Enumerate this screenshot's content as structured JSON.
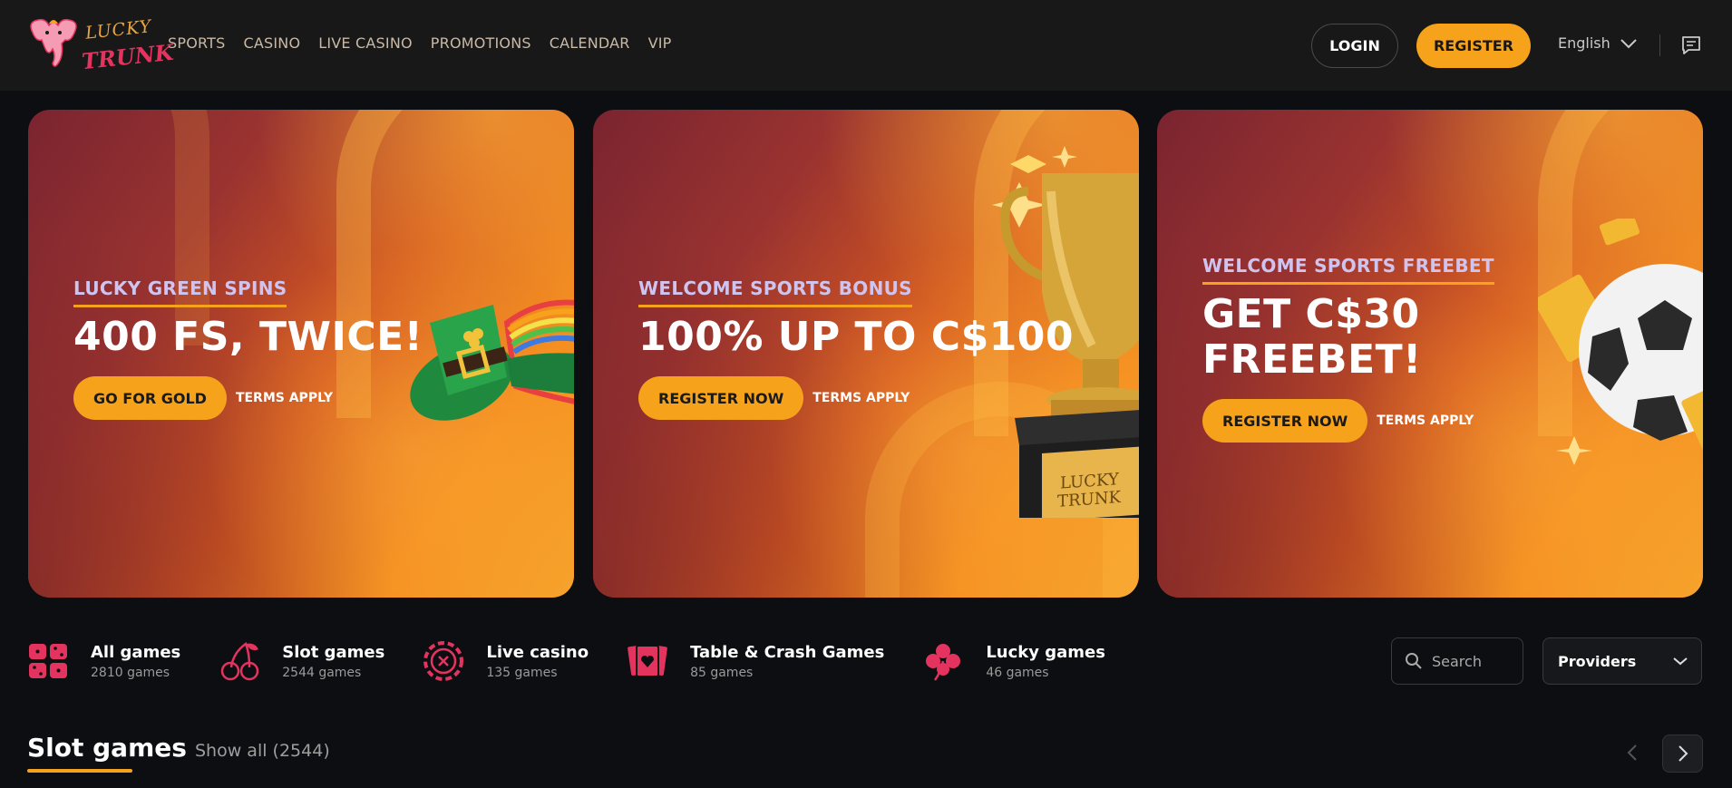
{
  "header": {
    "logo_line1": "LUCKY",
    "logo_line2": "TRUNK",
    "nav": [
      "SPORTS",
      "CASINO",
      "LIVE CASINO",
      "PROMOTIONS",
      "CALENDAR",
      "VIP"
    ],
    "login_label": "LOGIN",
    "register_label": "REGISTER",
    "language": "English"
  },
  "banners": [
    {
      "subtitle": "LUCKY GREEN SPINS",
      "title_lines": [
        "400 FS, TWICE!"
      ],
      "button": "GO FOR GOLD",
      "terms": "TERMS APPLY"
    },
    {
      "subtitle": "WELCOME SPORTS BONUS",
      "title_lines": [
        "100% UP TO C$100"
      ],
      "button": "REGISTER NOW",
      "terms": "TERMS APPLY"
    },
    {
      "subtitle": "WELCOME SPORTS FREEBET",
      "title_lines": [
        "GET C$30",
        "FREEBET!"
      ],
      "button": "REGISTER NOW",
      "terms": "TERMS APPLY"
    }
  ],
  "categories": [
    {
      "name": "All games",
      "count": "2810 games",
      "icon": "grid-dice-icon"
    },
    {
      "name": "Slot games",
      "count": "2544 games",
      "icon": "cherries-icon"
    },
    {
      "name": "Live casino",
      "count": "135 games",
      "icon": "roulette-chip-icon"
    },
    {
      "name": "Table & Crash Games",
      "count": "85 games",
      "icon": "playing-cards-icon"
    },
    {
      "name": "Lucky games",
      "count": "46 games",
      "icon": "clover-icon"
    }
  ],
  "search": {
    "placeholder": "Search"
  },
  "providers": {
    "label": "Providers"
  },
  "section": {
    "title": "Slot games",
    "show_all": "Show all (2544)"
  },
  "colors": {
    "accent": "#f7a21b",
    "brand_pink": "#e5335f",
    "background": "#0c0e11",
    "header": "#181818"
  }
}
